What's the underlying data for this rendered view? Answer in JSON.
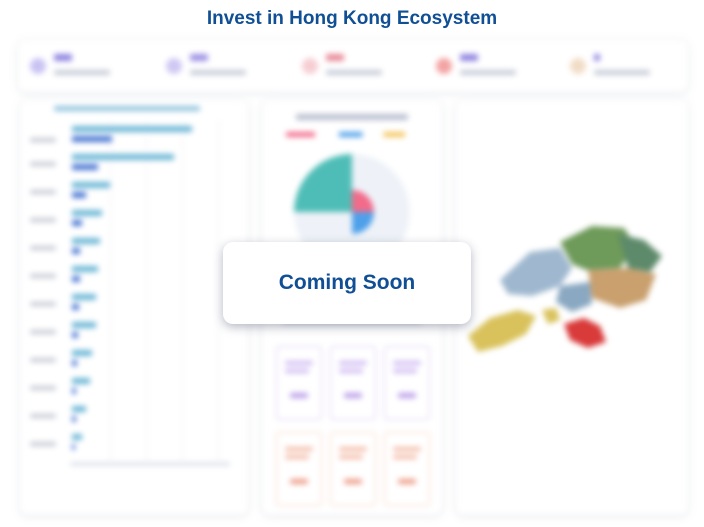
{
  "header": {
    "title": "Invest in Hong Kong Ecosystem"
  },
  "overlay": {
    "message": "Coming Soon"
  },
  "colors": {
    "title": "#114f95",
    "kpi_accents": [
      "#9b8fe6",
      "#a99ce8",
      "#f29aa6",
      "#ee6b6b",
      "#e8b88a"
    ],
    "bar_teal": "#6cb6d6",
    "bar_blue": "#4a77d4",
    "pie": [
      "#4fbdb7",
      "#f26b8a",
      "#4ea0ea",
      "#f3c55c",
      "#e9eef6"
    ],
    "map": [
      "#9fb8cf",
      "#5d8a6a",
      "#6e9a5a",
      "#d9c25c",
      "#c9a06e",
      "#d93a3a"
    ]
  },
  "icons": {
    "kpi": [
      "users-icon",
      "companies-icon",
      "heart-icon",
      "pin-icon",
      "star-icon"
    ]
  }
}
